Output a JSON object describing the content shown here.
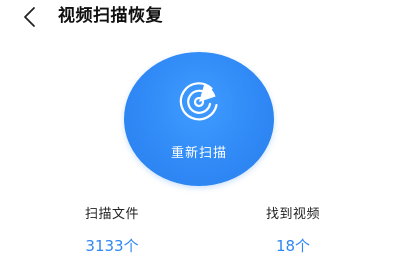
{
  "header": {
    "back_icon": "chevron-left-icon",
    "title": "视频扫描恢复"
  },
  "scan": {
    "icon": "radar-icon",
    "button_label": "重新扫描",
    "button_color": "#2f88f5"
  },
  "stats": {
    "files_label": "扫描文件",
    "files_value": "3133个",
    "videos_label": "找到视频",
    "videos_value": "18个",
    "value_color": "#2f88f5"
  }
}
